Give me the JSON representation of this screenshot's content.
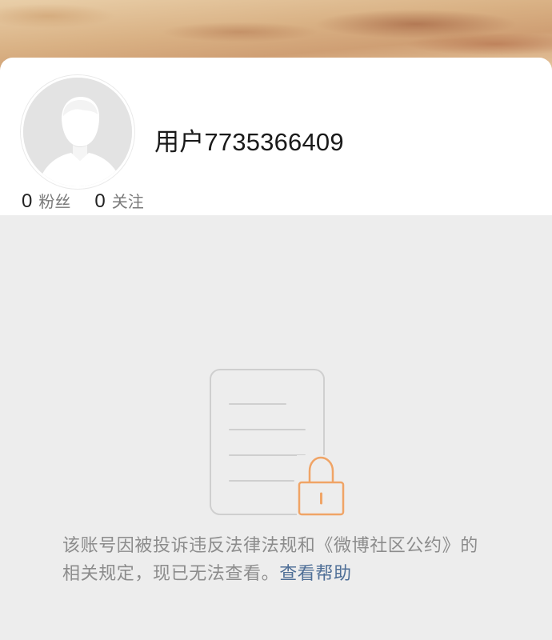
{
  "profile": {
    "username": "用户7735366409",
    "fans_count": "0",
    "fans_label": "粉丝",
    "following_count": "0",
    "following_label": "关注"
  },
  "notice": {
    "message": "该账号因被投诉违反法律法规和《微博社区公约》的相关规定，现已无法查看。",
    "help_link": "查看帮助"
  },
  "icons": {
    "avatar": "default-avatar-icon",
    "document": "document-icon",
    "lock": "lock-icon"
  },
  "colors": {
    "lock": "#f0a466",
    "link": "#4f6f97",
    "muted_text": "#8c8c8c"
  }
}
